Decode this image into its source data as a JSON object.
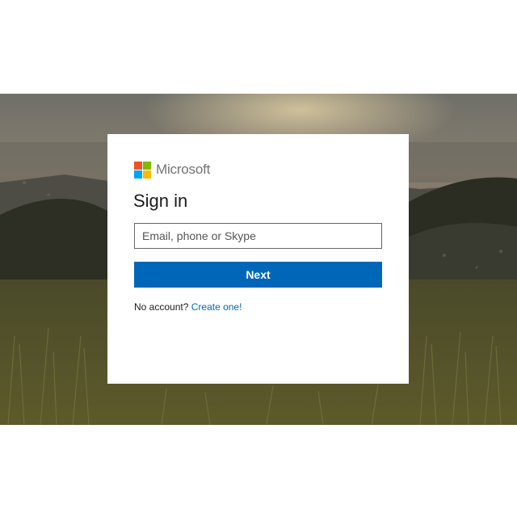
{
  "brand": {
    "name": "Microsoft",
    "logo_colors": [
      "#f25022",
      "#7fba00",
      "#00a4ef",
      "#ffb900"
    ]
  },
  "signin": {
    "title": "Sign in",
    "email_placeholder": "Email, phone or Skype",
    "email_value": "",
    "next_label": "Next",
    "no_account_text": "No account?",
    "create_link_label": "Create one!"
  },
  "colors": {
    "accent": "#0067b8",
    "card_background": "#ffffff"
  }
}
